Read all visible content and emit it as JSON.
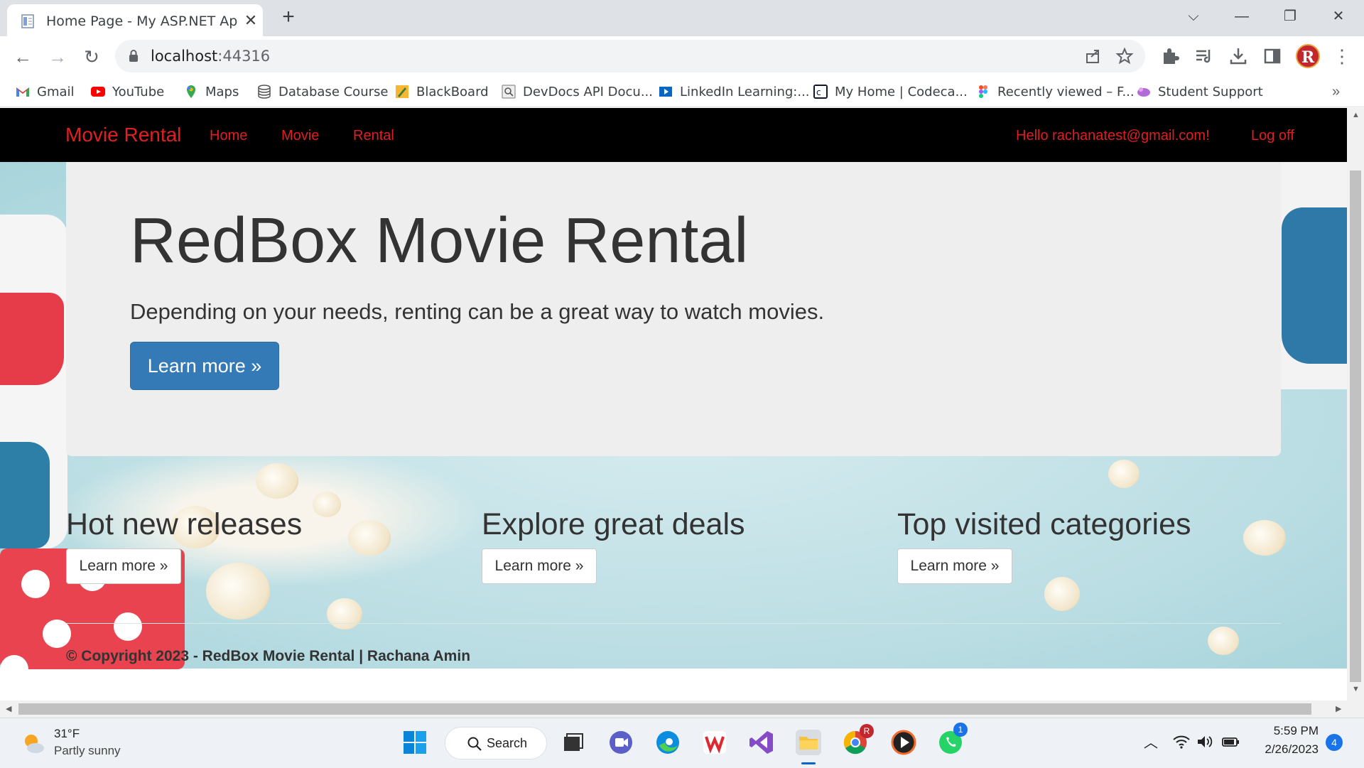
{
  "browser": {
    "tab_title": "Home Page - My ASP.NET Applic",
    "url_host": "localhost",
    "url_port": ":44316",
    "bookmarks": [
      {
        "label": "Gmail"
      },
      {
        "label": "YouTube"
      },
      {
        "label": "Maps"
      },
      {
        "label": "Database Course"
      },
      {
        "label": "BlackBoard"
      },
      {
        "label": "DevDocs API Docu..."
      },
      {
        "label": "LinkedIn Learning:..."
      },
      {
        "label": "My Home | Codeca..."
      },
      {
        "label": "Recently viewed – F..."
      },
      {
        "label": "Student Support"
      }
    ],
    "avatar_letter": "R",
    "more_bookmarks": "»"
  },
  "site": {
    "brand": "Movie Rental",
    "nav": {
      "home": "Home",
      "movie": "Movie",
      "rental": "Rental"
    },
    "user_greeting": "Hello rachanatest@gmail.com!",
    "logoff": "Log off",
    "jumbotron": {
      "title": "RedBox Movie Rental",
      "lead": "Depending on your needs, renting can be a great way to watch movies.",
      "button": "Learn more »"
    },
    "columns": [
      {
        "title": "Hot new releases",
        "button": "Learn more »"
      },
      {
        "title": "Explore great deals",
        "button": "Learn more »"
      },
      {
        "title": "Top visited categories",
        "button": "Learn more »"
      }
    ],
    "footer": "© Copyright 2023 - RedBox Movie Rental | Rachana Amin"
  },
  "taskbar": {
    "weather_temp": "31°F",
    "weather_desc": "Partly sunny",
    "search_label": "Search",
    "time": "5:59 PM",
    "date": "2/26/2023",
    "notifications": "4",
    "whatsapp_badge": "1"
  },
  "colors": {
    "accent_red": "#e01f1f",
    "primary_button": "#337ab7",
    "navbar_bg": "#000000"
  }
}
